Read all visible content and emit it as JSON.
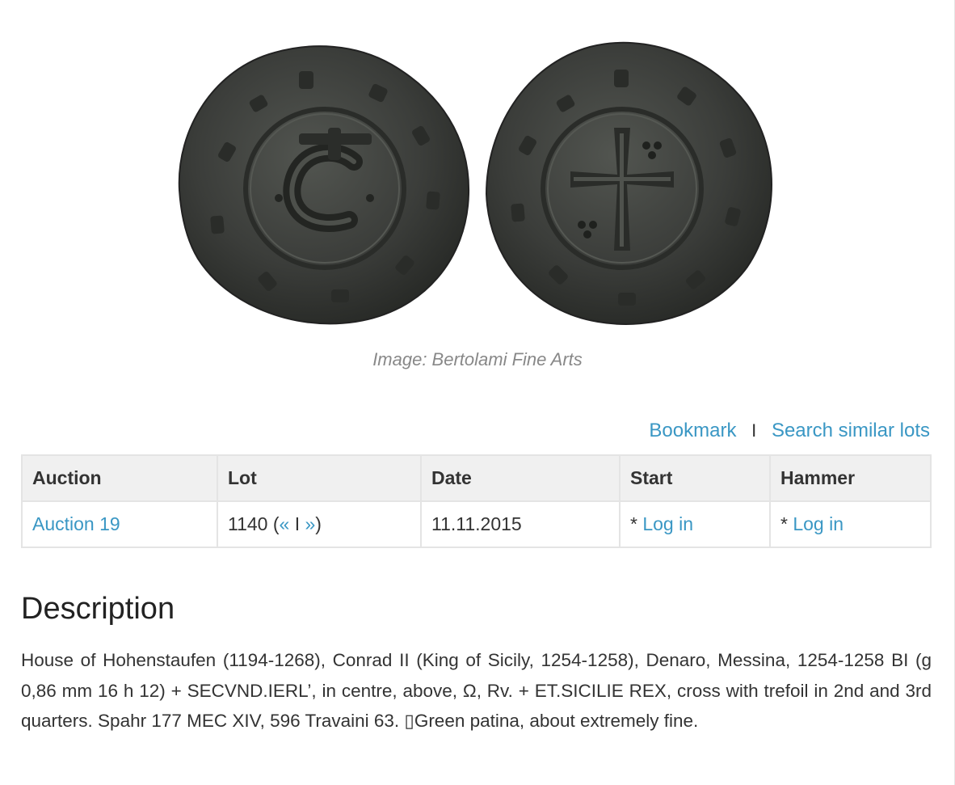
{
  "image": {
    "caption": "Image: Bertolami Fine Arts",
    "obverse": "coin-obverse-letter-c",
    "reverse": "coin-reverse-cross"
  },
  "actions": {
    "bookmark": "Bookmark",
    "separator": "I",
    "search_similar": "Search similar lots"
  },
  "table": {
    "headers": {
      "auction": "Auction",
      "lot": "Lot",
      "date": "Date",
      "start": "Start",
      "hammer": "Hammer"
    },
    "row": {
      "auction": "Auction 19",
      "lot_number": "1140",
      "lot_open": " (",
      "lot_prev": "«",
      "lot_sep": " I ",
      "lot_next": "»",
      "lot_close": ")",
      "date": "11.11.2015",
      "start_prefix": "* ",
      "start_link": "Log in",
      "hammer_prefix": "* ",
      "hammer_link": "Log in"
    }
  },
  "description": {
    "heading": "Description",
    "text": "House of Hohenstaufen (1194-1268), Conrad II (King of Sicily, 1254-1258), Denaro, Messina, 1254-1258 BI (g 0,86 mm 16 h 12) + SECVND.IERL’, in centre, above, Ω, Rv. + ET.SICILIE REX, cross with trefoil in 2nd and 3rd quarters. Spahr 177 MEC XIV, 596 Travaini 63. ▯Green patina, about extremely fine."
  },
  "colors": {
    "link": "#3a97c4",
    "header_bg": "#f0f0f0",
    "border": "#e4e4e4",
    "coin": "#3b3d3a"
  }
}
